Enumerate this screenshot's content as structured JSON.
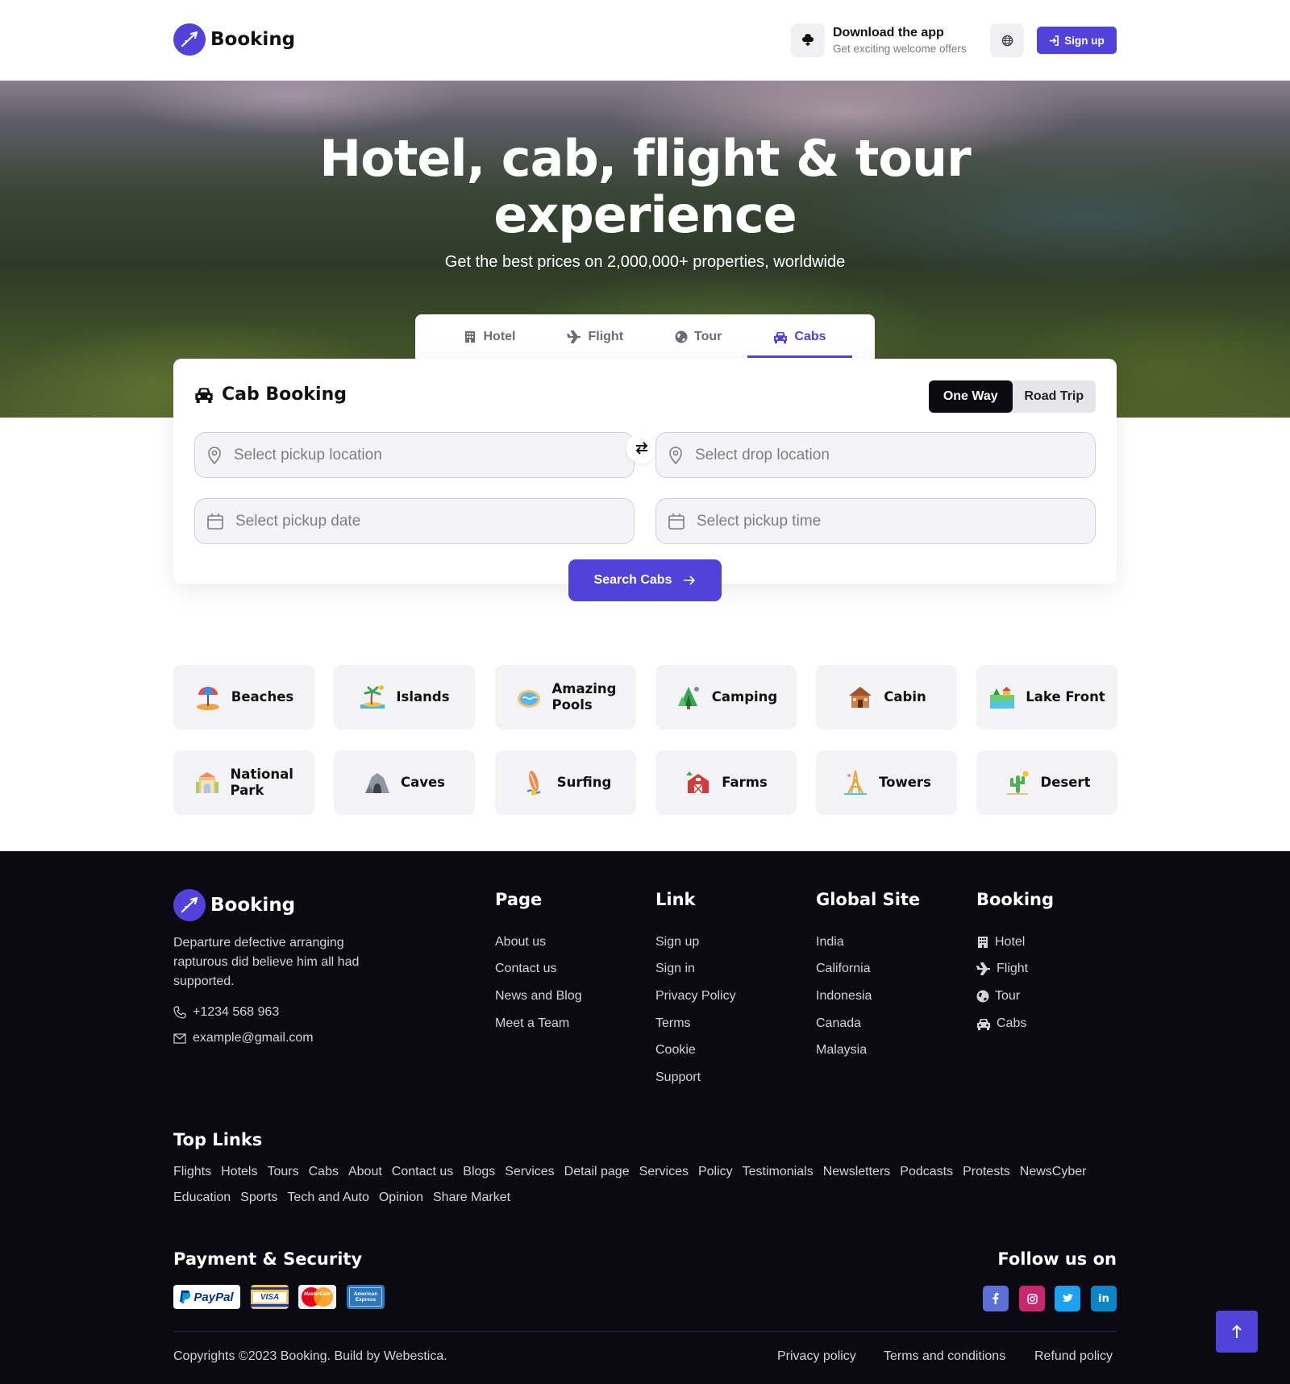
{
  "header": {
    "logo_text": "Booking",
    "download_title": "Download the app",
    "download_sub": "Get exciting welcome offers",
    "signup_label": "Sign up"
  },
  "hero": {
    "title_line1": "Hotel, cab, flight & tour",
    "title_line2": "experience",
    "subtitle": "Get the best prices on 2,000,000+ properties, worldwide"
  },
  "tabs": [
    {
      "label": "Hotel",
      "icon": "building-icon",
      "active": false
    },
    {
      "label": "Flight",
      "icon": "plane-icon",
      "active": false
    },
    {
      "label": "Tour",
      "icon": "globe-icon",
      "active": false
    },
    {
      "label": "Cabs",
      "icon": "car-icon",
      "active": true
    }
  ],
  "booking": {
    "title": "Cab Booking",
    "trip_types": [
      "One Way",
      "Road Trip"
    ],
    "selected_trip": "One Way",
    "pickup_placeholder": "Select pickup location",
    "drop_placeholder": "Select drop location",
    "date_placeholder": "Select pickup date",
    "time_placeholder": "Select pickup time",
    "search_label": "Search Cabs"
  },
  "categories": [
    {
      "label": "Beaches",
      "icon": "beach-umbrella-icon"
    },
    {
      "label": "Islands",
      "icon": "island-icon"
    },
    {
      "label": "Amazing Pools",
      "icon": "pool-icon"
    },
    {
      "label": "Camping",
      "icon": "tent-icon"
    },
    {
      "label": "Cabin",
      "icon": "cabin-icon"
    },
    {
      "label": "Lake Front",
      "icon": "lake-icon"
    },
    {
      "label": "National Park",
      "icon": "park-icon"
    },
    {
      "label": "Caves",
      "icon": "cave-icon"
    },
    {
      "label": "Surfing",
      "icon": "surfboard-icon"
    },
    {
      "label": "Farms",
      "icon": "barn-icon"
    },
    {
      "label": "Towers",
      "icon": "tower-icon"
    },
    {
      "label": "Desert",
      "icon": "cactus-icon"
    }
  ],
  "footer": {
    "logo_text": "Booking",
    "description": "Departure defective arranging rapturous did believe him all had supported.",
    "phone": "+1234 568 963",
    "email": "example@gmail.com",
    "columns": [
      {
        "title": "Page",
        "links": [
          "About us",
          "Contact us",
          "News and Blog",
          "Meet a Team"
        ]
      },
      {
        "title": "Link",
        "links": [
          "Sign up",
          "Sign in",
          "Privacy Policy",
          "Terms",
          "Cookie",
          "Support"
        ]
      },
      {
        "title": "Global Site",
        "links": [
          "India",
          "California",
          "Indonesia",
          "Canada",
          "Malaysia"
        ]
      },
      {
        "title": "Booking",
        "links": [
          "Hotel",
          "Flight",
          "Tour",
          "Cabs"
        ]
      }
    ],
    "top_links_title": "Top Links",
    "top_links": [
      "Flights",
      "Hotels",
      "Tours",
      "Cabs",
      "About",
      "Contact us",
      "Blogs",
      "Services",
      "Detail page",
      "Services",
      "Policy",
      "Testimonials",
      "Newsletters",
      "Podcasts",
      "Protests",
      "NewsCyber",
      "Education",
      "Sports",
      "Tech and Auto",
      "Opinion",
      "Share Market"
    ],
    "payment_title": "Payment & Security",
    "payment_methods": [
      "PayPal",
      "VISA",
      "MasterCard",
      "American Express"
    ],
    "follow_title": "Follow us on",
    "social": [
      "f",
      "ig",
      "tw",
      "in"
    ],
    "copyright": "Copyrights ©2023 Booking. Build by Webestica.",
    "bottom_links": [
      "Privacy policy",
      "Terms and conditions",
      "Refund policy"
    ]
  },
  "colors": {
    "accent": "#5143d9",
    "footer_bg": "#0b0a12"
  }
}
